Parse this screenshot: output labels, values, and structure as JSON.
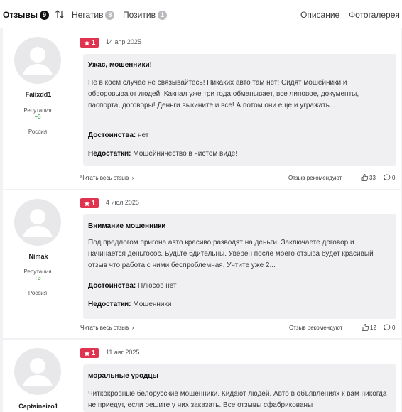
{
  "tabs": {
    "reviews_label": "Отзывы",
    "reviews_count": "9",
    "negative_label": "Негатив",
    "negative_count": "8",
    "positive_label": "Позитив",
    "positive_count": "1",
    "description_label": "Описание",
    "gallery_label": "Фотогалерея"
  },
  "labels": {
    "reputation": "Репутация",
    "pros": "Достоинства:",
    "cons": "Недостатки:",
    "read_all": "Читать весь отзыв",
    "recommend": "Отзыв рекомендуют"
  },
  "colors": {
    "rating_bg": "#e0334f",
    "reputation_positive": "#2e9b3f"
  },
  "reviews": [
    {
      "author": "Faiixdd1",
      "reputation": "+3",
      "country": "Россия",
      "rating": "1",
      "date": "14 апр 2025",
      "title": "Ужас, мошенники!",
      "text": "Не в коем случае не связывайтесь! Никаких авто там нет! Сидят мошейники и обворовывают людей! Какнал уже три года обманывает, все липовое, документы, паспорта, договоры! Деньги выкините и все! А потом они еще и угражать...",
      "pros": "нет",
      "cons": "Мошейничество в чистом виде!",
      "likes": "33",
      "comments": "0"
    },
    {
      "author": "Nimak",
      "reputation": "+3",
      "country": "Россия",
      "rating": "1",
      "date": "4 июл 2025",
      "title": "Внимание мошенники",
      "text": "Под предлогом пригона авто красиво разводят на деньги. Заключаете договор и начинается деньгосос. Будьте бдительны. Уверен после моего отзыва будет красивый отзыв что работа с ними беспроблемная. Учтите уже 2...",
      "pros": "Плюсов нет",
      "cons": "Мошенники",
      "likes": "12",
      "comments": "0"
    },
    {
      "author": "Captaineizo1",
      "rating": "1",
      "date": "11 авг 2025",
      "title": "моральные уродцы",
      "text": "Читкокровные белорусские мошенники. Кидают людей. Авто в объявлениях к вам никогда не приедут, если решите у них заказать. Все отзывы сфабрикованы"
    }
  ]
}
